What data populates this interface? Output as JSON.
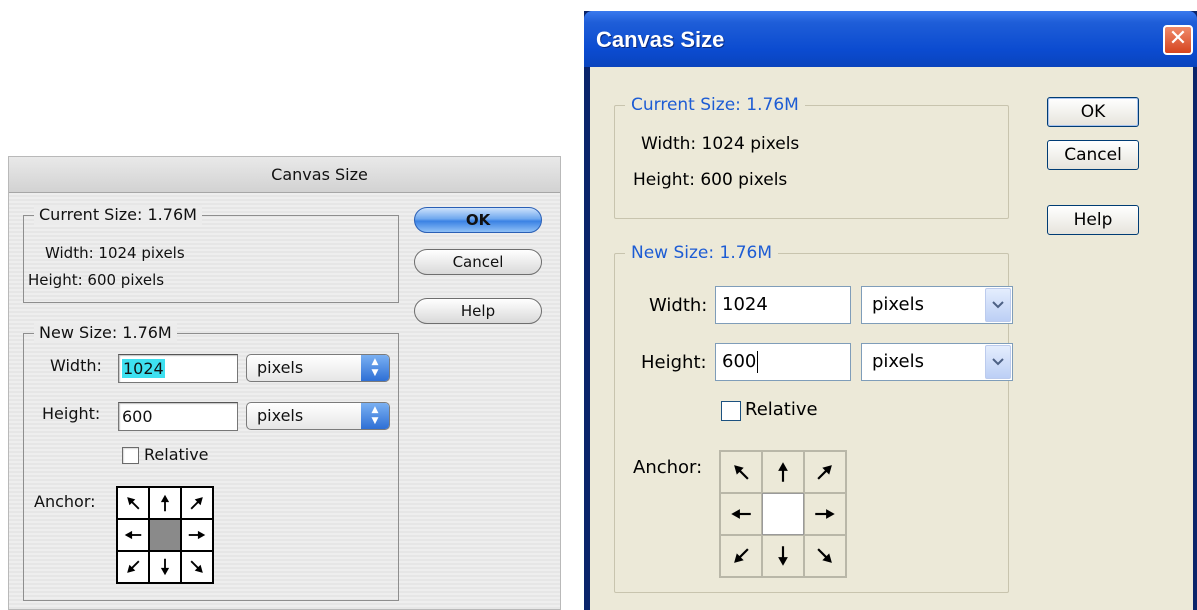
{
  "mac_dialog": {
    "title": "Canvas Size",
    "current_size": {
      "legend": "Current Size:  1.76M",
      "width_text": "Width:  1024 pixels",
      "height_text": "Height:  600 pixels"
    },
    "new_size": {
      "legend": "New Size:  1.76M",
      "width_label": "Width:",
      "width_value": "1024",
      "width_unit": "pixels",
      "height_label": "Height:",
      "height_value": "600",
      "height_unit": "pixels",
      "relative_label": "Relative",
      "relative_checked": false,
      "anchor_label": "Anchor:",
      "anchor_selected": "center"
    },
    "buttons": {
      "ok": "OK",
      "cancel": "Cancel",
      "help": "Help"
    }
  },
  "windows_dialog": {
    "title": "Canvas Size",
    "close_glyph": "✕",
    "current_size": {
      "legend": "Current Size: 1.76M",
      "width_text": "Width:  1024 pixels",
      "height_text": "Height:  600 pixels"
    },
    "new_size": {
      "legend": "New Size: 1.76M",
      "width_label": "Width:",
      "width_value": "1024",
      "width_unit": "pixels",
      "height_label": "Height:",
      "height_value": "600",
      "height_unit": "pixels",
      "relative_label": "Relative",
      "relative_checked": false,
      "anchor_label": "Anchor:",
      "anchor_selected": "center"
    },
    "buttons": {
      "ok": "OK",
      "cancel": "Cancel",
      "help": "Help"
    }
  },
  "colors": {
    "win_title_blue": "#0b4bd0",
    "win_legend_blue": "#1d5cd4",
    "win_face": "#ece9d8",
    "mac_selection": "#3ee0f0",
    "mac_default_button": "#3b82e4"
  }
}
